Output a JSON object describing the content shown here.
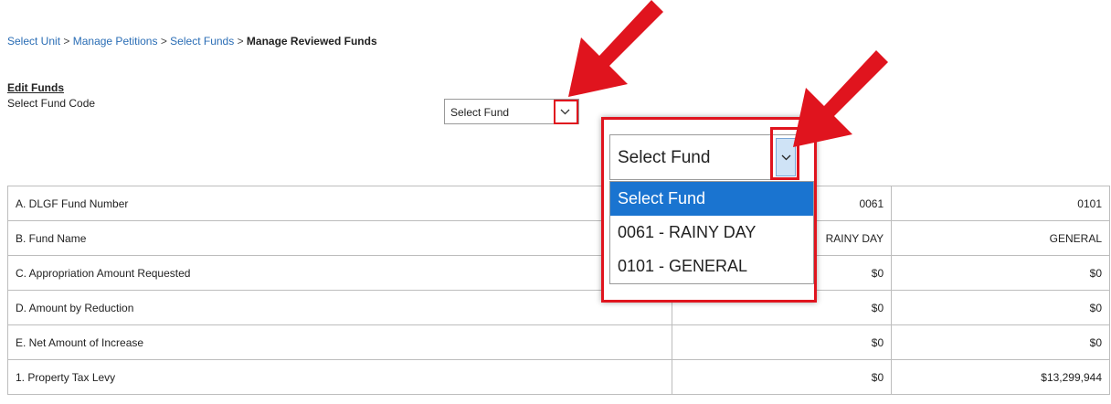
{
  "breadcrumb": {
    "items": [
      "Select Unit",
      "Manage Petitions",
      "Select Funds"
    ],
    "separator": ">",
    "current": "Manage Reviewed Funds"
  },
  "edit": {
    "title": "Edit Funds",
    "fund_code_label": "Select Fund Code"
  },
  "fund_select": {
    "value": "Select Fund",
    "options": [
      "Select Fund",
      "0061 - RAINY DAY",
      "0101 - GENERAL"
    ],
    "highlighted_option": "Select Fund"
  },
  "table": {
    "rows": [
      {
        "label": "A. DLGF Fund Number",
        "c1": "0061",
        "c2": "0101"
      },
      {
        "label": "B. Fund Name",
        "c1": "RAINY DAY",
        "c2": "GENERAL"
      },
      {
        "label": "C. Appropriation Amount Requested",
        "c1": "$0",
        "c2": "$0"
      },
      {
        "label": "D. Amount by Reduction",
        "c1": "$0",
        "c2": "$0"
      },
      {
        "label": "E. Net Amount of Increase",
        "c1": "$0",
        "c2": "$0"
      },
      {
        "label": "1. Property Tax Levy",
        "c1": "$0",
        "c2": "$13,299,944"
      }
    ]
  },
  "colors": {
    "annotation": "#e0141e",
    "link": "#2a6db5",
    "selected": "#1a74d0"
  }
}
